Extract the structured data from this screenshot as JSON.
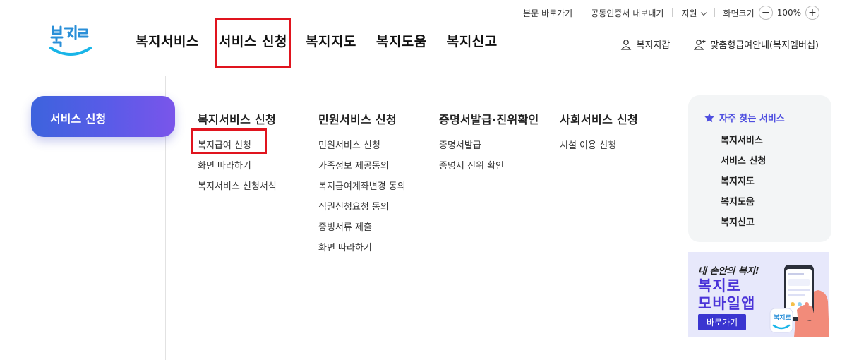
{
  "util": {
    "skip": "본문 바로가기",
    "cert": "공동인증서 내보내기",
    "support": "지원",
    "zoom_label": "화면크기",
    "zoom_minus": "−",
    "zoom_value": "100%",
    "zoom_plus": "+"
  },
  "logo": {
    "text": "복지로"
  },
  "gnb": {
    "items": [
      "복지서비스",
      "서비스 신청",
      "복지지도",
      "복지도움",
      "복지신고"
    ]
  },
  "header_right": {
    "wallet": "복지지갑",
    "membership": "맞춤형급여안내(복지멤버십)"
  },
  "side": {
    "title": "서비스 신청"
  },
  "columns": [
    {
      "title": "복지서비스 신청",
      "items": [
        "복지급여 신청",
        "화면 따라하기",
        "복지서비스 신청서식"
      ]
    },
    {
      "title": "민원서비스 신청",
      "items": [
        "민원서비스 신청",
        "가족정보 제공동의",
        "복지급여계좌변경 동의",
        "직권신청요청 동의",
        "증빙서류 제출",
        "화면 따라하기"
      ]
    },
    {
      "title": "증명서발급·진위확인",
      "items": [
        "증명서발급",
        "증명서 진위 확인"
      ]
    },
    {
      "title": "사회서비스 신청",
      "items": [
        "시설 이용 신청"
      ]
    }
  ],
  "favorites": {
    "title": "자주 찾는 서비스",
    "items": [
      "복지서비스",
      "서비스 신청",
      "복지지도",
      "복지도움",
      "복지신고"
    ]
  },
  "banner": {
    "line1": "내 손안의 복지!",
    "line2": "복지로",
    "line3": "모바일앱",
    "button": "바로가기",
    "app_icon_text": "복지로"
  },
  "colors": {
    "highlight": "#e0141e",
    "accent": "#4f4fe0",
    "pill_start": "#3d63dd",
    "pill_end": "#7a55ea"
  }
}
